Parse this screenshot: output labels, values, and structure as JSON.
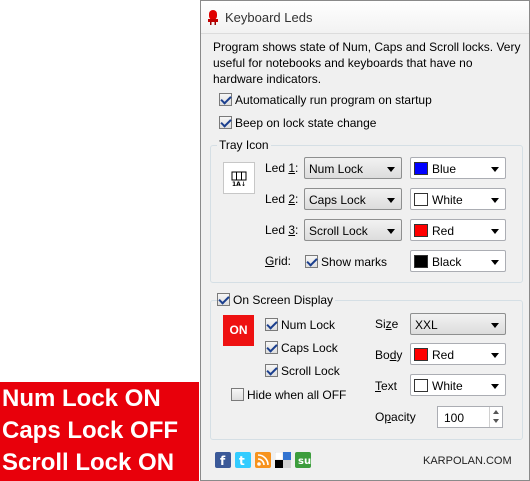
{
  "osd_overlay": {
    "lines": [
      "Num Lock ON",
      "Caps Lock OFF",
      "Scroll Lock ON"
    ],
    "background": "#e8000b"
  },
  "window": {
    "title": "Keyboard Leds",
    "description": "Program shows state of Num, Caps and Scroll locks. Very useful for notebooks and keyboards that have no hardware indicators.",
    "options": {
      "autorun_label": "Automatically run program on startup",
      "autorun_checked": true,
      "beep_label": "Beep on lock state change",
      "beep_checked": true
    },
    "tray": {
      "group_title": "Tray Icon",
      "tray_icon": "keyboard-leds-tray-icon",
      "led1": {
        "label_pre": "Led ",
        "label_key": "1",
        "label_post": ":",
        "lock": "Num Lock",
        "color_name": "Blue",
        "color": "#0000ff"
      },
      "led2": {
        "label_pre": "Led ",
        "label_key": "2",
        "label_post": ":",
        "lock": "Caps Lock",
        "color_name": "White",
        "color": "#ffffff"
      },
      "led3": {
        "label_pre": "Led ",
        "label_key": "3",
        "label_post": ":",
        "lock": "Scroll Lock",
        "color_name": "Red",
        "color": "#ff0000"
      },
      "grid": {
        "label_key": "G",
        "label_rest": "rid:",
        "show_marks_label": "Show marks",
        "show_marks_checked": true,
        "color_name": "Black",
        "color": "#000000"
      }
    },
    "osd": {
      "group_title": "On Screen Display",
      "enabled": true,
      "badge": "ON",
      "num_lock_label": "Num Lock",
      "num_lock_checked": true,
      "caps_lock_label": "Caps Lock",
      "caps_lock_checked": true,
      "scroll_lock_label": "Scroll Lock",
      "scroll_lock_checked": true,
      "hide_label": "Hide when all OFF",
      "hide_checked": false,
      "size": {
        "label_pre": "Si",
        "label_key": "z",
        "label_post": "e",
        "value": "XXL"
      },
      "body": {
        "label_pre": "Bo",
        "label_key": "d",
        "label_post": "y",
        "color_name": "Red",
        "color": "#ff0000"
      },
      "text": {
        "label_key": "T",
        "label_rest": "ext",
        "color_name": "White",
        "color": "#ffffff"
      },
      "opacity": {
        "label_pre": "O",
        "label_key": "p",
        "label_post": "acity",
        "value": "100"
      }
    },
    "footer": {
      "icons": [
        "facebook-icon",
        "twitter-icon",
        "rss-icon",
        "delicious-icon",
        "stumbleupon-icon"
      ],
      "site": "KARPOLAN.COM"
    }
  }
}
